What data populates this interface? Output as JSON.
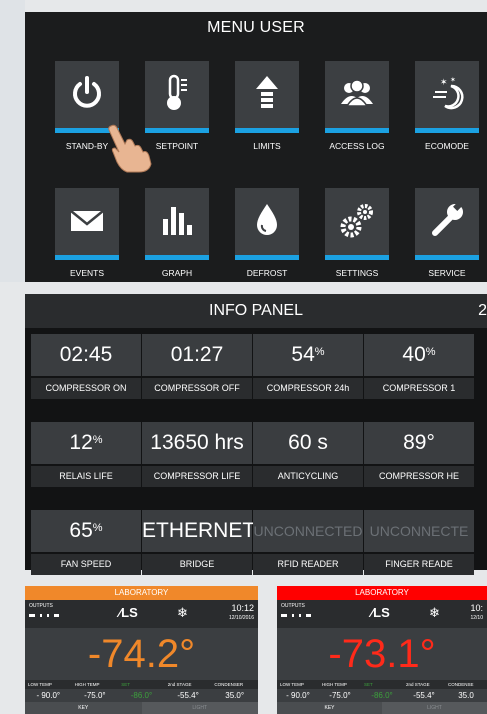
{
  "menu": {
    "title": "MENU USER",
    "items": [
      {
        "label": "STAND-BY",
        "icon": "power-icon"
      },
      {
        "label": "SETPOINT",
        "icon": "thermometer-icon"
      },
      {
        "label": "LIMITS",
        "icon": "arrow-up-icon"
      },
      {
        "label": "ACCESS LOG",
        "icon": "users-icon"
      },
      {
        "label": "ECOMODE",
        "icon": "moon-stars-icon"
      },
      {
        "label": "EVENTS",
        "icon": "envelope-icon"
      },
      {
        "label": "GRAPH",
        "icon": "bar-chart-icon"
      },
      {
        "label": "DEFROST",
        "icon": "drop-icon"
      },
      {
        "label": "SETTINGS",
        "icon": "gears-icon"
      },
      {
        "label": "SERVICE",
        "icon": "wrench-icon"
      }
    ],
    "accent": "#1ba1e2"
  },
  "info": {
    "title": "INFO PANEL",
    "corner": "2",
    "cells": [
      {
        "value": "02:45",
        "unit": "",
        "label": "COMPRESSOR ON"
      },
      {
        "value": "01:27",
        "unit": "",
        "label": "COMPRESSOR OFF"
      },
      {
        "value": "54",
        "unit": "%",
        "label": "COMPRESSOR 24h"
      },
      {
        "value": "40",
        "unit": "%",
        "label": "COMPRESSOR 1"
      },
      {
        "value": "12",
        "unit": "%",
        "label": "RELAIS LIFE"
      },
      {
        "value": "13650 hrs",
        "unit": "",
        "label": "COMPRESSOR LIFE"
      },
      {
        "value": "60 s",
        "unit": "",
        "label": "ANTICYCLING"
      },
      {
        "value": "89°",
        "unit": "",
        "label": "COMPRESSOR HE"
      },
      {
        "value": "65",
        "unit": "%",
        "label": "FAN SPEED"
      },
      {
        "value": "ETHERNET",
        "unit": "",
        "label": "BRIDGE"
      },
      {
        "value": "UNCONNECTED",
        "unit": "",
        "label": "RFID READER"
      },
      {
        "value": "UNCONNECTE",
        "unit": "",
        "label": "FINGER READE"
      }
    ]
  },
  "cards": [
    {
      "header": "LABORATORY",
      "header_color": "#f0882a",
      "outputs": "OUTPUTS",
      "logo": "LS",
      "time": "10:12",
      "date": "12/10/2016",
      "temp": "-74.2°",
      "temp_color": "#f0882a",
      "labels": [
        "LOW TEMP",
        "HIGH TEMP",
        "SET",
        "2nd STAGE",
        "CONDENSER"
      ],
      "values": [
        "- 90.0°",
        "-75.0°",
        "-86.0°",
        "-55.4°",
        "35.0°"
      ],
      "key": "KEY",
      "key2": "LIGHT"
    },
    {
      "header": "LABORATORY",
      "header_color": "#ff0000",
      "outputs": "OUTPUTS",
      "logo": "LS",
      "time": "10:",
      "date": "12/10",
      "temp": "-73.1°",
      "temp_color": "#ff2a1a",
      "labels": [
        "LOW TEMP",
        "HIGH TEMP",
        "SET",
        "2nd STAGE",
        "CONDENSE"
      ],
      "values": [
        "- 90.0°",
        "-75.0°",
        "-86.0°",
        "-55.4°",
        "35.0"
      ],
      "key": "KEY",
      "key2": "LIGHT"
    }
  ]
}
